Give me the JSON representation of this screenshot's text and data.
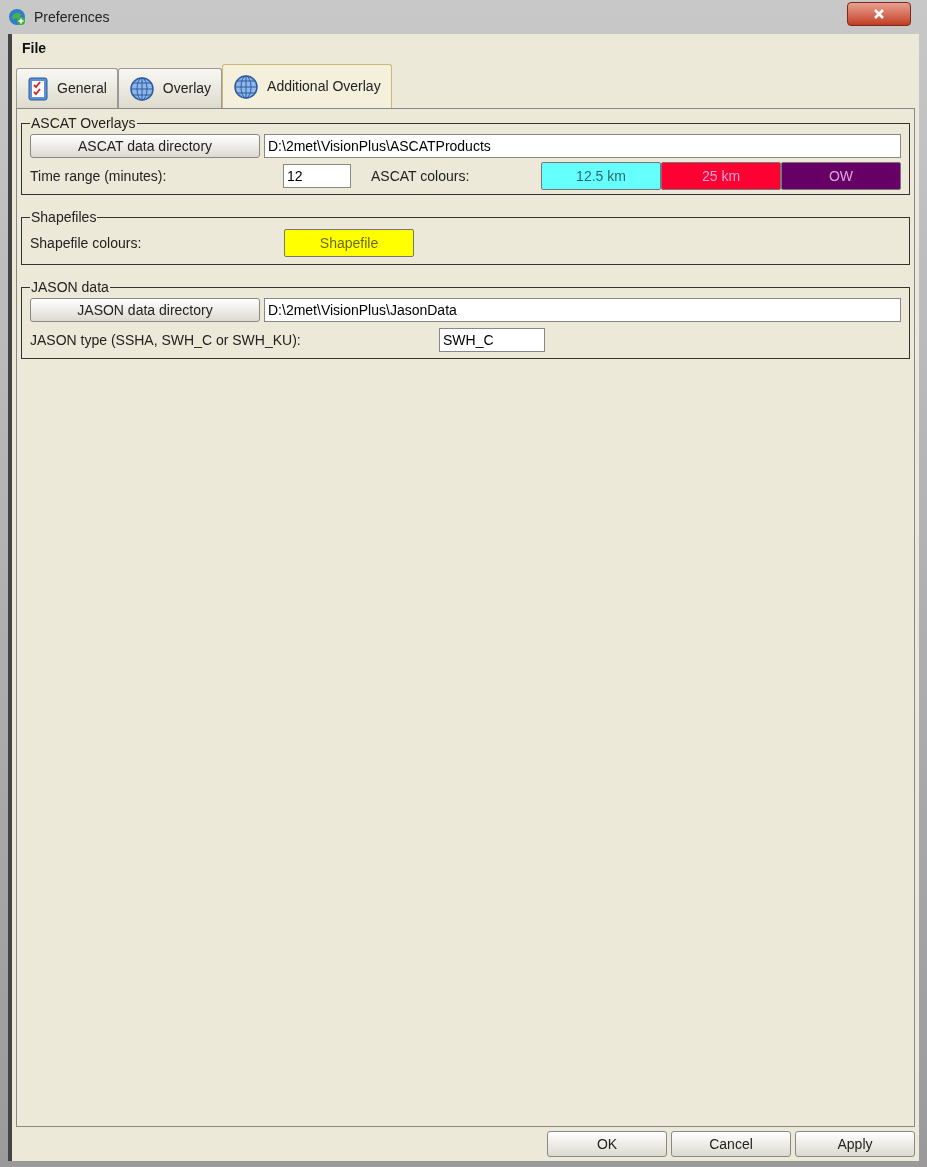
{
  "window": {
    "title": "Preferences"
  },
  "menu": [
    {
      "label": "File"
    }
  ],
  "tabs": [
    {
      "label": "General",
      "kind": "checklist",
      "selected": false
    },
    {
      "label": "Overlay",
      "kind": "globe",
      "selected": false
    },
    {
      "label": "Additional Overlay",
      "kind": "globe",
      "selected": true
    }
  ],
  "ascat": {
    "title": "ASCAT Overlays",
    "dir_button": "ASCAT data directory",
    "dir_value": "D:\\2met\\VisionPlus\\ASCATProducts",
    "time_label": "Time range (minutes):",
    "time_value": "12",
    "colours_label": "ASCAT colours:",
    "colours": [
      {
        "label": "12.5 km",
        "color": "#66ffff"
      },
      {
        "label": "25 km",
        "color": "#ff0033"
      },
      {
        "label": "OW",
        "color": "#660066"
      }
    ]
  },
  "shapefiles": {
    "title": "Shapefiles",
    "colours_label": "Shapefile colours:",
    "colours": [
      {
        "label": "Shapefile",
        "color": "#ffff00"
      }
    ]
  },
  "jason": {
    "title": "JASON data",
    "dir_button": "JASON data directory",
    "dir_value": "D:\\2met\\VisionPlus\\JasonData",
    "type_label": "JASON type (SSHA, SWH_C or SWH_KU):",
    "type_value": "SWH_C"
  },
  "buttons": [
    "OK",
    "Cancel",
    "Apply"
  ]
}
